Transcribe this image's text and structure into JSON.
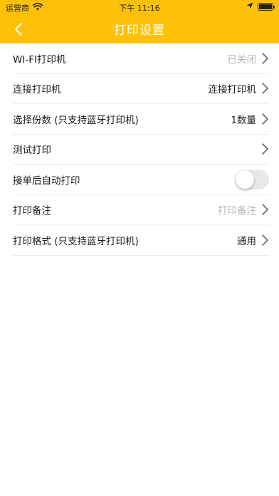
{
  "status_bar": {
    "carrier": "运营商",
    "time": "下午 11:16",
    "battery_level": 1.0,
    "icons": [
      "wifi-icon",
      "location-arrow-icon",
      "battery-icon"
    ]
  },
  "navbar": {
    "title": "打印设置",
    "back_icon": "chevron-left-icon",
    "background": "#FFC107"
  },
  "settings": {
    "items": [
      {
        "label": "WI-FI打印机",
        "value": "已关闭",
        "value_muted": true
      },
      {
        "label": "连接打印机",
        "value": "连接打印机",
        "value_muted": false
      },
      {
        "label": "选择份数 (只支持蓝牙打印机)",
        "value": "1数量",
        "value_muted": false
      },
      {
        "label": "测试打印",
        "value": "",
        "value_muted": false
      },
      {
        "label": "接单后自动打印",
        "toggle": false
      },
      {
        "label": "打印备注",
        "value": "打印备注",
        "value_muted": true
      },
      {
        "label": "打印格式 (只支持蓝牙打印机)",
        "value": "通用",
        "value_muted": false
      }
    ]
  }
}
